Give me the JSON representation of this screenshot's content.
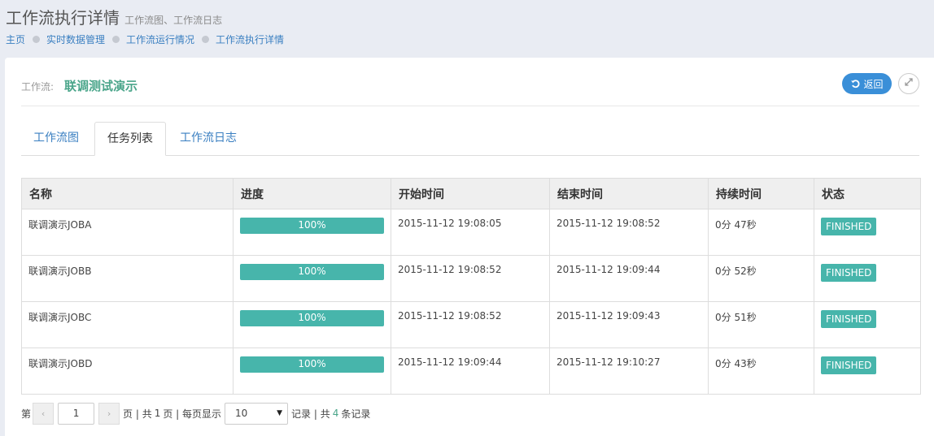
{
  "header": {
    "title": "工作流执行详情",
    "subtitle": "工作流图、工作流日志"
  },
  "breadcrumb": [
    "主页",
    "实时数据管理",
    "工作流运行情况",
    "工作流执行详情"
  ],
  "workflow": {
    "label": "工作流:",
    "name": "联调测试演示"
  },
  "buttons": {
    "back_label": "返回",
    "back_icon": "undo-icon",
    "expand_icon": "expand-icon"
  },
  "tabs": [
    {
      "label": "工作流图",
      "active": false
    },
    {
      "label": "任务列表",
      "active": true
    },
    {
      "label": "工作流日志",
      "active": false
    }
  ],
  "table": {
    "columns": [
      "名称",
      "进度",
      "开始时间",
      "结束时间",
      "持续时间",
      "状态"
    ],
    "rows": [
      {
        "name": "联调演示JOBA",
        "progress": "100%",
        "start": "2015-11-12 19:08:05",
        "end": "2015-11-12 19:08:52",
        "duration": "0分 47秒",
        "status": "FINISHED"
      },
      {
        "name": "联调演示JOBB",
        "progress": "100%",
        "start": "2015-11-12 19:08:52",
        "end": "2015-11-12 19:09:44",
        "duration": "0分 52秒",
        "status": "FINISHED"
      },
      {
        "name": "联调演示JOBC",
        "progress": "100%",
        "start": "2015-11-12 19:08:52",
        "end": "2015-11-12 19:09:43",
        "duration": "0分 51秒",
        "status": "FINISHED"
      },
      {
        "name": "联调演示JOBD",
        "progress": "100%",
        "start": "2015-11-12 19:09:44",
        "end": "2015-11-12 19:10:27",
        "duration": "0分 43秒",
        "status": "FINISHED"
      }
    ]
  },
  "pager": {
    "prefix": "第",
    "current_page": "1",
    "page_text": "页 | 共",
    "total_pages": "1",
    "page_text2": "页 | 每页显示",
    "page_size": "10",
    "records_text": "记录 | 共",
    "total_records": "4",
    "records_suffix": "条记录"
  },
  "colors": {
    "accent": "#3a8fd8",
    "success": "#47b5ab",
    "workflow_name": "#4aa58a"
  }
}
